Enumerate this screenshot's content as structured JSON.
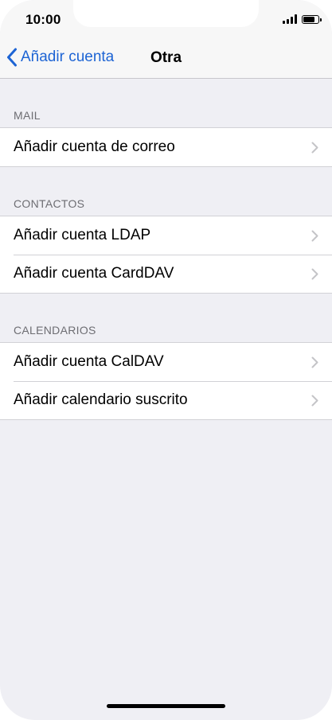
{
  "status_bar": {
    "time": "10:00",
    "signal_icon": "cellular-signal-icon",
    "battery_icon": "battery-icon",
    "battery_level": 0.8
  },
  "nav": {
    "back_label": "Añadir cuenta",
    "back_icon": "chevron-left-icon",
    "title": "Otra"
  },
  "sections": {
    "mail": {
      "header": "MAIL",
      "rows": [
        "Añadir cuenta de correo"
      ]
    },
    "contacts": {
      "header": "CONTACTOS",
      "rows": [
        "Añadir cuenta LDAP",
        "Añadir cuenta CardDAV"
      ]
    },
    "calendars": {
      "header": "CALENDARIOS",
      "rows": [
        "Añadir cuenta CalDAV",
        "Añadir calendario suscrito"
      ]
    }
  },
  "colors": {
    "accent": "#1d64d4",
    "background": "#efeff4",
    "separator": "#d1d1d6",
    "chevron": "#c4c4c7"
  }
}
